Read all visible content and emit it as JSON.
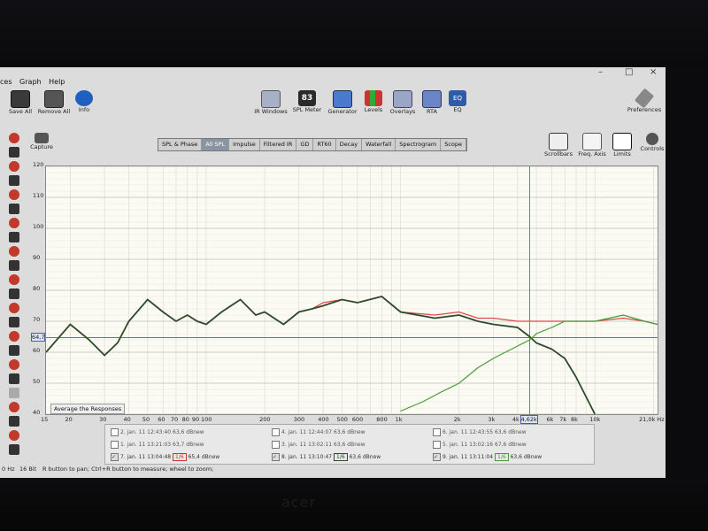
{
  "window": {
    "controls": [
      "–",
      "□",
      "×"
    ]
  },
  "menu": [
    "ces",
    "Graph",
    "Help"
  ],
  "toolbar_left": [
    {
      "label": "Save All",
      "icon": "save-icon"
    },
    {
      "label": "Remove All",
      "icon": "remove-icon"
    },
    {
      "label": "Info",
      "icon": "info-icon"
    }
  ],
  "toolbar_center": [
    {
      "label": "IR Windows",
      "icon": "ir-windows-icon"
    },
    {
      "label": "SPL Meter",
      "icon": "spl-meter-icon",
      "badge": "83"
    },
    {
      "label": "Generator",
      "icon": "generator-icon"
    },
    {
      "label": "Levels",
      "icon": "levels-icon"
    },
    {
      "label": "Overlays",
      "icon": "overlays-icon"
    },
    {
      "label": "RTA",
      "icon": "rta-icon"
    },
    {
      "label": "EQ",
      "icon": "eq-icon"
    }
  ],
  "preferences_label": "Preferences",
  "capture_label": "Capture",
  "tabs": [
    "SPL & Phase",
    "All SPL",
    "Impulse",
    "Filtered IR",
    "GD",
    "RT60",
    "Decay",
    "Waterfall",
    "Spectrogram",
    "Scope"
  ],
  "active_tab": "All SPL",
  "graph_controls": [
    {
      "label": "Scrollbars",
      "icon": "scrollbars-icon"
    },
    {
      "label": "Freq. Axis",
      "icon": "freq-axis-icon"
    },
    {
      "label": "Limits",
      "icon": "limits-icon"
    },
    {
      "label": "Controls",
      "icon": "controls-icon"
    }
  ],
  "average_button": "Average the Responses",
  "cursor_level": "64,7",
  "cursor_freq": "4,62k",
  "chart_data": {
    "type": "line",
    "xscale": "log",
    "xlim": [
      15,
      21000
    ],
    "ylim": [
      40,
      120
    ],
    "y_ticks": [
      40,
      50,
      60,
      70,
      80,
      90,
      100,
      110,
      120
    ],
    "x_ticks": [
      {
        "v": 15,
        "t": "15"
      },
      {
        "v": 20,
        "t": "20"
      },
      {
        "v": 30,
        "t": "30"
      },
      {
        "v": 40,
        "t": "40"
      },
      {
        "v": 50,
        "t": "50"
      },
      {
        "v": 60,
        "t": "60"
      },
      {
        "v": 70,
        "t": "70"
      },
      {
        "v": 80,
        "t": "80"
      },
      {
        "v": 90,
        "t": "90"
      },
      {
        "v": 100,
        "t": "100"
      },
      {
        "v": 200,
        "t": "200"
      },
      {
        "v": 300,
        "t": "300"
      },
      {
        "v": 400,
        "t": "400"
      },
      {
        "v": 500,
        "t": "500"
      },
      {
        "v": 600,
        "t": "600"
      },
      {
        "v": 800,
        "t": "800"
      },
      {
        "v": 1000,
        "t": "1k"
      },
      {
        "v": 2000,
        "t": "2k"
      },
      {
        "v": 3000,
        "t": "3k"
      },
      {
        "v": 4000,
        "t": "4k"
      },
      {
        "v": 6000,
        "t": "6k"
      },
      {
        "v": 7000,
        "t": "7k"
      },
      {
        "v": 8000,
        "t": "8k"
      },
      {
        "v": 10000,
        "t": "10k"
      },
      {
        "v": 21000,
        "t": "21,0k Hz"
      }
    ],
    "cursor": {
      "x": 4620,
      "y": 64.7
    },
    "series": [
      {
        "color": "#e04848",
        "x": [
          15,
          20,
          25,
          30,
          35,
          40,
          50,
          60,
          70,
          80,
          90,
          100,
          120,
          150,
          180,
          200,
          250,
          300,
          350,
          400,
          500,
          600,
          800,
          1000,
          1500,
          2000,
          2500,
          3000,
          4000,
          5000,
          6000,
          8000,
          10000,
          14000,
          18000,
          21000
        ],
        "y": [
          60,
          69,
          64,
          59,
          63,
          70,
          77,
          73,
          70,
          72,
          70,
          69,
          73,
          77,
          72,
          73,
          69,
          73,
          74,
          76,
          77,
          76,
          78,
          73,
          72,
          73,
          71,
          71,
          70,
          70,
          70,
          70,
          70,
          71,
          70,
          69
        ]
      },
      {
        "color": "#2e4a2a",
        "x": [
          15,
          20,
          25,
          30,
          35,
          40,
          50,
          60,
          70,
          80,
          90,
          100,
          120,
          150,
          180,
          200,
          250,
          300,
          350,
          400,
          500,
          600,
          800,
          1000,
          1500,
          2000,
          2500,
          3000,
          4000,
          4620,
          5000,
          6000,
          7000,
          8000,
          10000
        ],
        "y": [
          60,
          69,
          64,
          59,
          63,
          70,
          77,
          73,
          70,
          72,
          70,
          69,
          73,
          77,
          72,
          73,
          69,
          73,
          74,
          75,
          77,
          76,
          78,
          73,
          71,
          72,
          70,
          69,
          68,
          65,
          63,
          61,
          58,
          52,
          40
        ]
      },
      {
        "color": "#4a9a3a",
        "x": [
          1000,
          1300,
          1600,
          2000,
          2500,
          3000,
          4000,
          4620,
          5000,
          6000,
          7000,
          8000,
          10000,
          14000,
          18000,
          21000
        ],
        "y": [
          41,
          44,
          47,
          50,
          55,
          58,
          62,
          64,
          66,
          68,
          70,
          70,
          70,
          72,
          70,
          69
        ]
      }
    ]
  },
  "legend": [
    {
      "label": "2. jan. 11 12:43:40",
      "value": "63,6 dB",
      "tag": "new",
      "checked": false
    },
    {
      "label": "4. jan. 11 12:44:07",
      "value": "63,6 dB",
      "tag": "new",
      "checked": false
    },
    {
      "label": "6. jan. 11 12:43:55",
      "value": "63,6 dB",
      "tag": "new",
      "checked": false
    },
    {
      "label": "1. jan. 11 13:21:03",
      "value": "63,7 dB",
      "tag": "new",
      "checked": false
    },
    {
      "label": "3. jan. 11 13:02:11",
      "value": "63,6 dB",
      "tag": "new",
      "checked": false
    },
    {
      "label": "5. jan. 11 13:02:16",
      "value": "67,6 dB",
      "tag": "new",
      "checked": false
    },
    {
      "label": "7. jan. 11 13:04:48",
      "value": "65,4 dB",
      "tag": "new",
      "smooth": "1/6",
      "checked": true
    },
    {
      "label": "8. jan. 11 13:10:47",
      "value": "63,6 dB",
      "tag": "new",
      "smooth": "1/6",
      "checked": true
    },
    {
      "label": "9. jan. 11 13:11:04",
      "value": "63,6 dB",
      "tag": "new",
      "smooth": "1/6",
      "checked": true
    }
  ],
  "status": {
    "rate": "0 Hz",
    "bits": "16 Bit",
    "hint": "R button to pan; Ctrl+R button to measure; wheel to zoom;"
  }
}
